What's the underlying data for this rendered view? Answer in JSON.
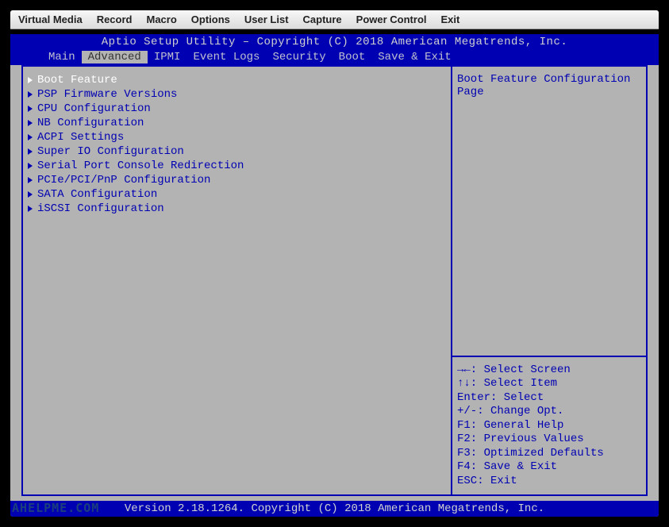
{
  "app_menu": {
    "items": [
      "Virtual Media",
      "Record",
      "Macro",
      "Options",
      "User List",
      "Capture",
      "Power Control",
      "Exit"
    ]
  },
  "bios": {
    "title": "Aptio Setup Utility – Copyright (C) 2018 American Megatrends, Inc.",
    "tabs": [
      "Main",
      "Advanced",
      "IPMI",
      "Event Logs",
      "Security",
      "Boot",
      "Save & Exit"
    ],
    "active_tab_index": 1,
    "menu_items": [
      "Boot Feature",
      "PSP Firmware Versions",
      "CPU Configuration",
      "NB Configuration",
      "ACPI Settings",
      "Super IO Configuration",
      "Serial Port Console Redirection",
      "PCIe/PCI/PnP Configuration",
      "SATA Configuration",
      "iSCSI Configuration"
    ],
    "selected_menu_index": 0,
    "help_text": "Boot Feature Configuration Page",
    "key_help": [
      "→←: Select Screen",
      "↑↓: Select Item",
      "Enter: Select",
      "+/-: Change Opt.",
      "F1: General Help",
      "F2: Previous Values",
      "F3: Optimized Defaults",
      "F4: Save & Exit",
      "ESC: Exit"
    ],
    "footer": "Version 2.18.1264. Copyright (C) 2018 American Megatrends, Inc."
  },
  "watermark": "AHELPME.COM"
}
